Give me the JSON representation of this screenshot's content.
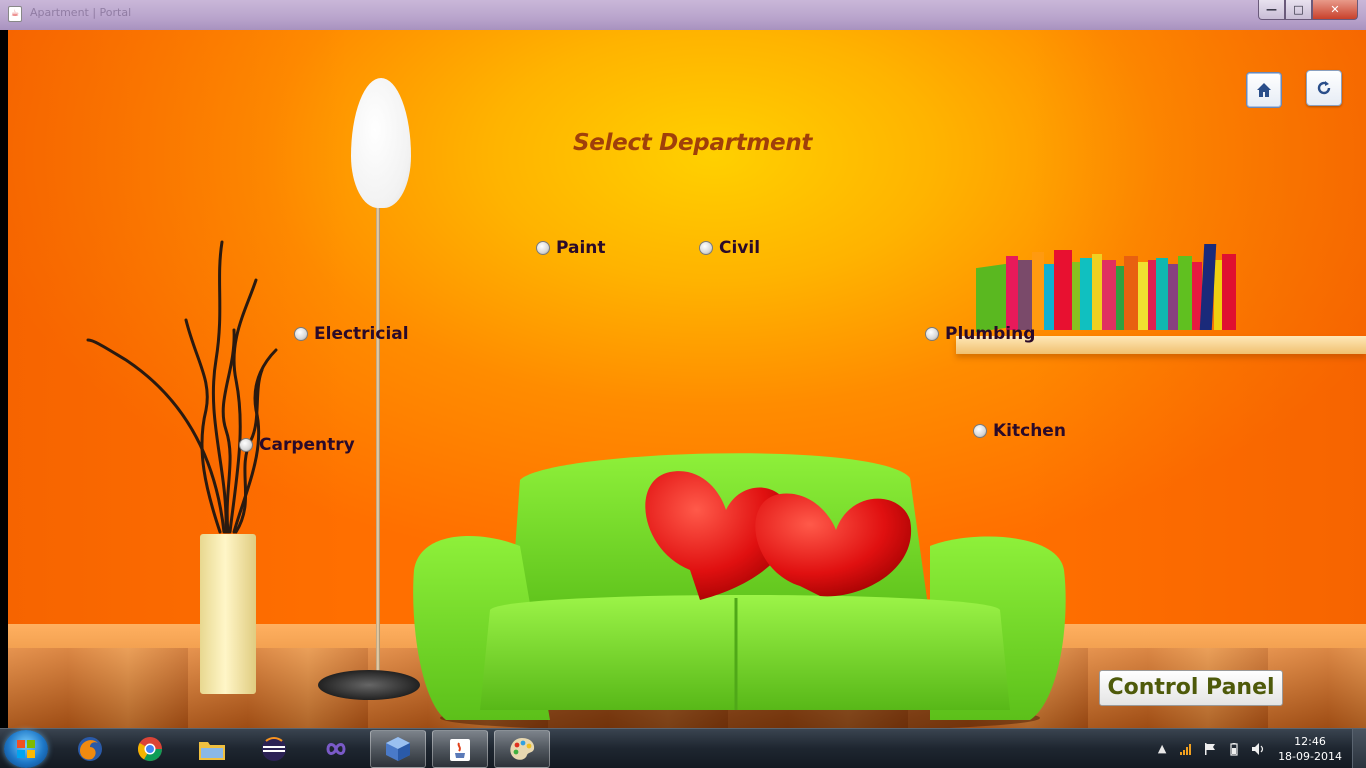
{
  "window": {
    "title": "Apartment | Portal",
    "controls": {
      "minimize": "—",
      "maximize": "□",
      "close": "✕"
    }
  },
  "page": {
    "heading": "Select Department",
    "departments": [
      {
        "label": "Paint",
        "selected": false
      },
      {
        "label": "Civil",
        "selected": false
      },
      {
        "label": "Electricial",
        "selected": false
      },
      {
        "label": "Plumbing",
        "selected": false
      },
      {
        "label": "Carpentry",
        "selected": false
      },
      {
        "label": "Kitchen",
        "selected": false
      }
    ],
    "home_button_icon": "home-icon",
    "refresh_button_icon": "refresh-icon",
    "control_panel_label": "Control Panel"
  },
  "taskbar": {
    "pinned": [
      {
        "name": "firefox",
        "icon": "firefox-icon"
      },
      {
        "name": "chrome",
        "icon": "chrome-icon"
      },
      {
        "name": "explorer",
        "icon": "folder-icon"
      },
      {
        "name": "eclipse",
        "icon": "eclipse-icon"
      },
      {
        "name": "visual-studio",
        "icon": "infinity-icon"
      },
      {
        "name": "virtualbox",
        "icon": "cube-icon"
      },
      {
        "name": "java",
        "icon": "java-icon"
      },
      {
        "name": "paint",
        "icon": "palette-icon"
      }
    ],
    "clock": {
      "time": "12:46",
      "date": "18-09-2014"
    }
  },
  "colors": {
    "heading": "#a0400a",
    "option_label": "#2a0a2a",
    "control_panel_text": "#4e5a0a",
    "wall_center": "#ffd000",
    "wall_edge": "#ff6f00",
    "sofa": "#7ee02a",
    "heart": "#e01010"
  }
}
